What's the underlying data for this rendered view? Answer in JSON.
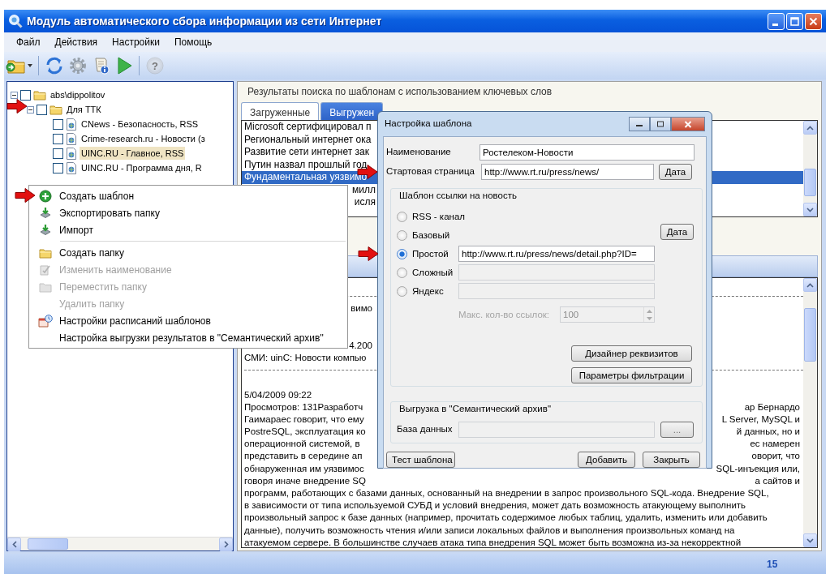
{
  "window": {
    "title": "Модуль автоматического сбора информации из сети Интернет"
  },
  "menu": [
    "Файл",
    "Действия",
    "Настройки",
    "Помощь"
  ],
  "toolbar": [
    {
      "kind": "folder-menu",
      "disabled": false
    },
    {
      "kind": "separator"
    },
    {
      "kind": "refresh",
      "disabled": false
    },
    {
      "kind": "gear",
      "disabled": false
    },
    {
      "kind": "document-info",
      "disabled": false
    },
    {
      "kind": "play",
      "disabled": false
    },
    {
      "kind": "separator"
    },
    {
      "kind": "help",
      "glyph": "?",
      "disabled": true
    }
  ],
  "tree": [
    {
      "label": "abs\\dippolitov",
      "expanded": true,
      "checked": false,
      "selected": false,
      "marked": false,
      "children": [
        {
          "label": "Для ТТК",
          "expanded": true,
          "checked": false,
          "selected": false,
          "marked": true,
          "children": [
            {
              "label": "CNews - Безопасность, RSS",
              "checked": false,
              "selected": false,
              "marked": false
            },
            {
              "label": "Crime-research.ru - Новости (з",
              "checked": false,
              "selected": false,
              "marked": false
            },
            {
              "label": "UINC.RU - Главное, RSS",
              "checked": false,
              "selected": true,
              "marked": false
            },
            {
              "label": "UINC.RU - Программа дня, R",
              "checked": false,
              "selected": false,
              "marked": false
            }
          ]
        }
      ]
    }
  ],
  "results": {
    "heading": "Результаты поиска по шаблонам с использованием ключевых слов",
    "tabs": [
      {
        "label": "Загруженные",
        "selected": true
      },
      {
        "label": "Выгружен",
        "selected": false
      }
    ],
    "list": [
      {
        "kind": "head",
        "text": "Microsoft сертифицировал п",
        "selected": false
      },
      {
        "kind": "head",
        "text": "Региональный интернет ока",
        "selected": false
      },
      {
        "kind": "head",
        "text": "Развитие сети интернет зак",
        "selected": false
      },
      {
        "kind": "head",
        "text": "Путин назвал прошлый год",
        "selected": false
      },
      {
        "kind": "head",
        "text": "Фундаментальная уязвимо",
        "selected": true
      },
      {
        "kind": "tail",
        "text": "милл",
        "selected": false
      },
      {
        "kind": "tail",
        "text": "исля",
        "selected": false
      }
    ],
    "detail": [
      {
        "kind": "rule"
      },
      {
        "kind": "tail",
        "text": "вимо"
      },
      {
        "kind": "tail",
        "text": "4.200"
      },
      {
        "kind": "head",
        "text": "СМИ: uinC: Новости компью"
      },
      {
        "kind": "rule"
      },
      {
        "kind": "date",
        "text": "5/04/2009 09:22"
      },
      {
        "kind": "split",
        "left": "Просмотров: 131Разработч",
        "right": "ар Бернардо"
      },
      {
        "kind": "split",
        "left": "Гаимараес говорит, что ему",
        "right": "L Server, MySQL и"
      },
      {
        "kind": "split",
        "left": "PostreSQL, эксплуатация ко",
        "right": "й данных, но и"
      },
      {
        "kind": "split",
        "left": "операционной системой, в",
        "right": "ес намерен"
      },
      {
        "kind": "split",
        "left": "представить в середине ап",
        "right": "оворит, что"
      },
      {
        "kind": "split",
        "left": "обнаруженная им уязвимос",
        "right": "SQL-инъекция или,"
      },
      {
        "kind": "split",
        "left": "говоря иначе внедрение SQ",
        "right": "а сайтов и"
      },
      {
        "kind": "line",
        "text": "программ, работающих с базами данных, основанный на внедрении в запрос произвольного SQL-кода. Внедрение SQL,"
      },
      {
        "kind": "line",
        "text": "в зависимости от типа используемой СУБД и условий внедрения, может дать возможность атакующему выполнить"
      },
      {
        "kind": "line",
        "text": "произвольный запрос к базе данных (например, прочитать содержимое любых таблиц, удалить, изменить или добавить"
      },
      {
        "kind": "line",
        "text": "данные), получить возможность чтения и/или записи локальных файлов и выполнения произвольных команд на"
      },
      {
        "kind": "line",
        "text": "атакуемом сервере. В большинстве случаев атака типа внедрения SQL может быть возможна из-за некорректной"
      }
    ]
  },
  "context_menu": [
    {
      "label": "Создать шаблон",
      "kind": "add",
      "disabled": false,
      "marked": true,
      "separator_after": false
    },
    {
      "label": "Экспортировать папку",
      "kind": "export",
      "disabled": false,
      "marked": false,
      "separator_after": false
    },
    {
      "label": "Импорт",
      "kind": "import",
      "disabled": false,
      "marked": false,
      "separator_after": true
    },
    {
      "label": "Создать  папку",
      "kind": "folder",
      "disabled": false,
      "marked": false,
      "separator_after": false
    },
    {
      "label": "Изменить наименование",
      "kind": "rename",
      "disabled": true,
      "marked": false,
      "separator_after": false
    },
    {
      "label": "Переместить папку",
      "kind": "move",
      "disabled": true,
      "marked": false,
      "separator_after": false
    },
    {
      "label": "Удалить папку",
      "kind": "plain",
      "disabled": true,
      "marked": false,
      "separator_after": false
    },
    {
      "label": "Настройки расписаний шаблонов",
      "kind": "schedule",
      "disabled": false,
      "marked": false,
      "separator_after": false
    },
    {
      "label": "Настройка выгрузки результатов в \"Семантический архив\"",
      "kind": "plain",
      "disabled": false,
      "marked": false,
      "separator_after": false
    }
  ],
  "dialog": {
    "title": "Настройка шаблона",
    "name": {
      "label": "Наименование",
      "value": "Ростелеком-Новости"
    },
    "start_page": {
      "label": "Стартовая страница",
      "value": "http://www.rt.ru/press/news/",
      "button": "Дата",
      "marked": true
    },
    "link_group": {
      "title": "Шаблон ссылки на новость",
      "date_button": "Дата",
      "options": [
        {
          "kind": "plain",
          "label": "RSS - канал",
          "selected": false,
          "marked": false
        },
        {
          "kind": "plain",
          "label": "Базовый",
          "selected": false,
          "marked": false
        },
        {
          "kind": "field",
          "label": "Простой",
          "selected": true,
          "marked": true,
          "value": "http://www.rt.ru/press/news/detail.php?ID=",
          "disabled": false
        },
        {
          "kind": "field",
          "label": "Сложный",
          "selected": false,
          "marked": false,
          "disabled": true
        },
        {
          "kind": "field",
          "label": "Яндекс",
          "selected": false,
          "marked": false,
          "disabled": true
        }
      ],
      "max_links": {
        "label": "Макс. кол-во ссылок:",
        "value": "100",
        "disabled": true
      },
      "buttons": [
        "Дизайнер реквизитов",
        "Параметры фильтрации"
      ]
    },
    "export_group": {
      "title": "Выгрузка в \"Семантический архив\"",
      "db_label": "База данных",
      "db_disabled": true,
      "browse_button": "..."
    },
    "test_button": "Тест шаблона",
    "add_button": "Добавить",
    "close_button": "Закрыть"
  },
  "status_bar": {
    "count": "15"
  }
}
